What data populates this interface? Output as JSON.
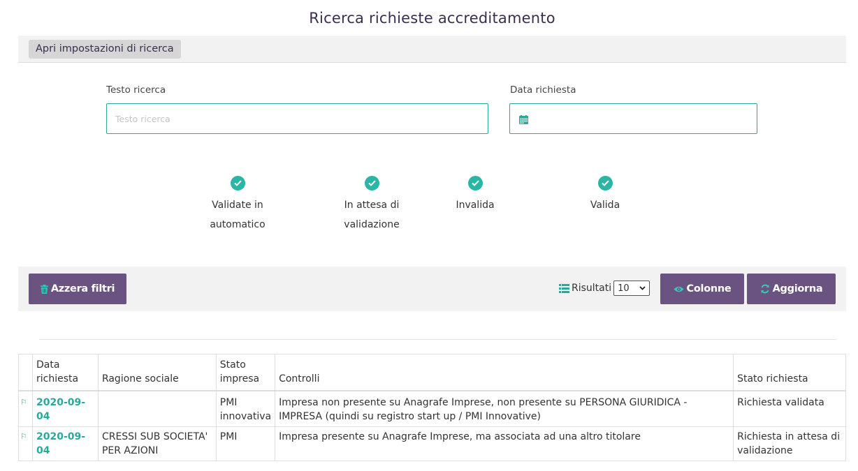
{
  "page": {
    "title": "Ricerca richieste accreditamento"
  },
  "settings": {
    "toggle_label": "Apri impostazioni di ricerca"
  },
  "search": {
    "text_label": "Testo ricerca",
    "text_placeholder": "Testo ricerca",
    "text_value": "",
    "date_label": "Data richiesta",
    "date_value": ""
  },
  "status_filters": [
    {
      "label": "Validate in automatico",
      "checked": true
    },
    {
      "label": "In attesa di validazione",
      "checked": true
    },
    {
      "label": "Invalida",
      "checked": true
    },
    {
      "label": "Valida",
      "checked": true
    }
  ],
  "toolbar": {
    "reset_label": "Azzera filtri",
    "results_label": "Risultati",
    "results_value": "10",
    "columns_label": "Colonne",
    "refresh_label": "Aggiorna"
  },
  "table": {
    "headers": [
      "",
      "Data richiesta",
      "Ragione sociale",
      "Stato impresa",
      "Controlli",
      "Stato richiesta"
    ],
    "rows": [
      {
        "flag": "⚐",
        "data_richiesta": "2020-09-04",
        "ragione_sociale": "",
        "stato_impresa": "PMI innovativa",
        "controlli": "Impresa non presente su Anagrafe Imprese, non presente su PERSONA GIURIDICA - IMPRESA (quindi su registro start up / PMI Innovative)",
        "stato_richiesta": "Richiesta validata"
      },
      {
        "flag": "⚐",
        "data_richiesta": "2020-09-04",
        "ragione_sociale": "CRESSI SUB SOCIETA' PER AZIONI",
        "stato_impresa": "PMI",
        "controlli": "Impresa presente su Anagrafe Imprese, ma associata ad una altro titolare",
        "stato_richiesta": "Richiesta in attesa di validazione"
      }
    ]
  },
  "colors": {
    "accent_teal": "#2ab5a5",
    "button_purple": "#6a5380",
    "title_purple": "#3b2d4f"
  },
  "icons": {
    "calendar": "calendar-icon",
    "check": "check-icon",
    "trash": "trash-icon",
    "list": "list-icon",
    "eye": "eye-icon",
    "refresh": "refresh-icon",
    "flag": "flag-icon"
  }
}
